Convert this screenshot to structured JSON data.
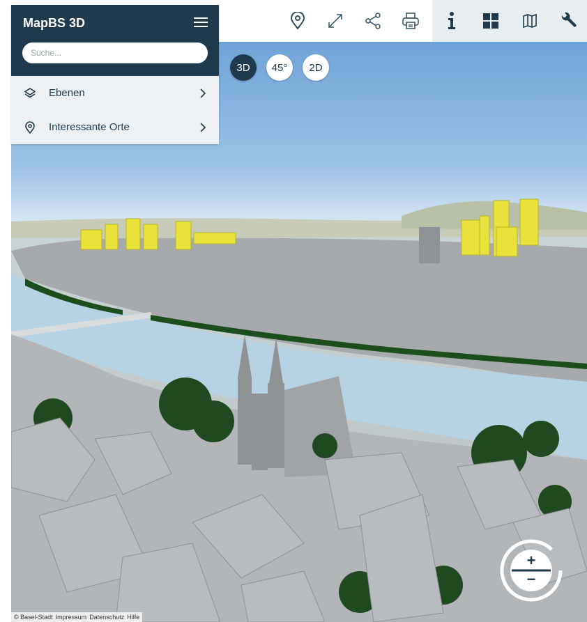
{
  "app": {
    "title": "MapBS 3D"
  },
  "search": {
    "placeholder": "Suche..."
  },
  "sidebar": {
    "items": [
      {
        "label": "Ebenen",
        "icon": "layers-icon"
      },
      {
        "label": "Interessante Orte",
        "icon": "location-pin-icon"
      }
    ]
  },
  "toolbar": {
    "tools": [
      {
        "name": "location-pin-icon"
      },
      {
        "name": "expand-icon"
      },
      {
        "name": "share-icon"
      },
      {
        "name": "print-icon"
      },
      {
        "name": "info-icon"
      },
      {
        "name": "grid-icon"
      },
      {
        "name": "map-icon"
      },
      {
        "name": "wrench-icon"
      }
    ]
  },
  "view_modes": {
    "items": [
      "3D",
      "45°",
      "2D"
    ],
    "active": "3D"
  },
  "zoom": {
    "plus": "+",
    "minus": "−"
  },
  "footer": {
    "copyright": "© Basel-Stadt",
    "links": [
      "Impressum",
      "Datenschutz",
      "Hilfe"
    ]
  },
  "colors": {
    "brand": "#1e3a4c",
    "highlight_buildings": "#e8e23a",
    "river": "#b7d3e3",
    "buildings": "#a9adb0",
    "trees": "#1c4d1c"
  }
}
